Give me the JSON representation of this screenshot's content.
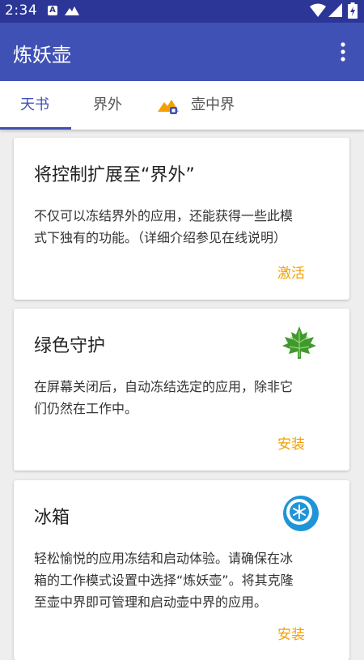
{
  "status_bar": {
    "time": "2:34",
    "notification_icons": [
      "a-app-icon",
      "mountain-icon"
    ],
    "system_icons": [
      "wifi-icon",
      "signal-icon",
      "battery-icon"
    ]
  },
  "app_bar": {
    "title": "炼妖壶",
    "menu_icon": "more-vert-icon"
  },
  "tabs": [
    {
      "label": "天书",
      "active": true
    },
    {
      "label": "界外",
      "active": false
    },
    {
      "label": "壶中界",
      "active": false,
      "icon": "mountain-icon"
    }
  ],
  "colors": {
    "primary": "#3f51b5",
    "primary_dark": "#2b3697",
    "accent": "#f5a000"
  },
  "cards": [
    {
      "title": "将控制扩展至“界外”",
      "body_line1": "不仅可以冻结界外的应用，还能获得一些此模",
      "body_line2": "式下独有的功能。（详细介绍参见在线说明）",
      "action": "激活",
      "icon": ""
    },
    {
      "title": "绿色守护",
      "body_line1": "在屏幕关闭后，自动冻结选定的应用，除非它",
      "body_line2": "们仍然在工作中。",
      "action": "安装",
      "icon": "maple-leaf-icon"
    },
    {
      "title": "冰箱",
      "body_line1": "轻松愉悦的应用冻结和启动体验。请确保在冰",
      "body_line2": "箱的工作模式设置中选择“炼妖壶”。将其克隆",
      "body_line3": "至壶中界即可管理和启动壶中界的应用。",
      "action": "安装",
      "icon": "snowflake-icon"
    }
  ]
}
